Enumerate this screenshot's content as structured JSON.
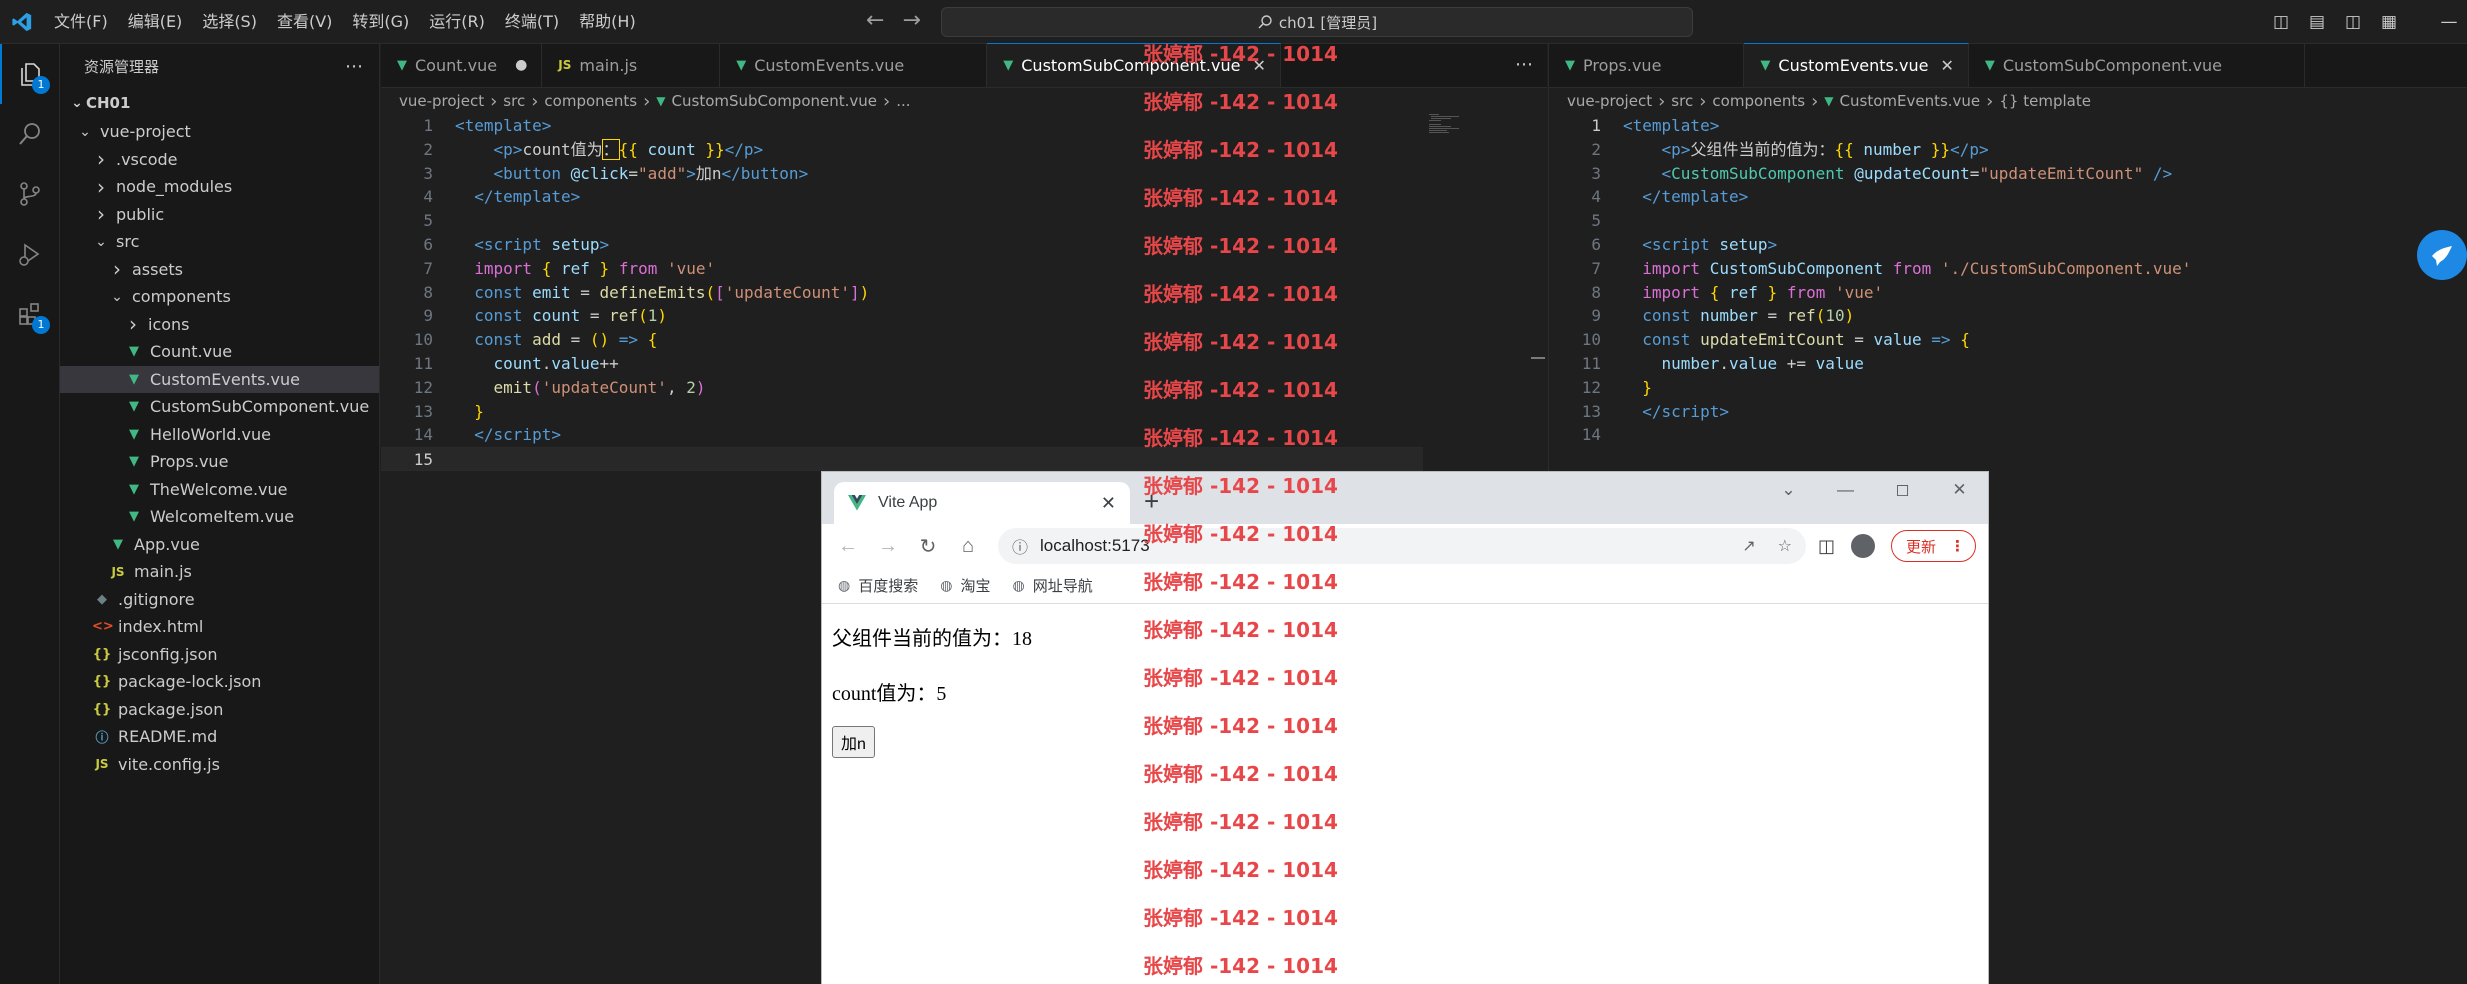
{
  "titlebar": {
    "menus": [
      "文件(F)",
      "编辑(E)",
      "选择(S)",
      "查看(V)",
      "转到(G)",
      "运行(R)",
      "终端(T)",
      "帮助(H)"
    ],
    "command_center": "ch01 [管理员]"
  },
  "activity": {
    "explorer_badge": "1",
    "extensions_badge": "1"
  },
  "explorer": {
    "title": "资源管理器",
    "root": "CH01",
    "tree": [
      {
        "label": "vue-project",
        "depth": 0,
        "chev": "v",
        "icon": ""
      },
      {
        "label": ".vscode",
        "depth": 1,
        "chev": ">",
        "icon": ""
      },
      {
        "label": "node_modules",
        "depth": 1,
        "chev": ">",
        "icon": ""
      },
      {
        "label": "public",
        "depth": 1,
        "chev": ">",
        "icon": ""
      },
      {
        "label": "src",
        "depth": 1,
        "chev": "v",
        "icon": ""
      },
      {
        "label": "assets",
        "depth": 2,
        "chev": ">",
        "icon": ""
      },
      {
        "label": "components",
        "depth": 2,
        "chev": "v",
        "icon": ""
      },
      {
        "label": "icons",
        "depth": 3,
        "chev": ">",
        "icon": ""
      },
      {
        "label": "Count.vue",
        "depth": 3,
        "chev": "",
        "icon": "vue"
      },
      {
        "label": "CustomEvents.vue",
        "depth": 3,
        "chev": "",
        "icon": "vue",
        "selected": true
      },
      {
        "label": "CustomSubComponent.vue",
        "depth": 3,
        "chev": "",
        "icon": "vue"
      },
      {
        "label": "HelloWorld.vue",
        "depth": 3,
        "chev": "",
        "icon": "vue"
      },
      {
        "label": "Props.vue",
        "depth": 3,
        "chev": "",
        "icon": "vue"
      },
      {
        "label": "TheWelcome.vue",
        "depth": 3,
        "chev": "",
        "icon": "vue"
      },
      {
        "label": "WelcomeItem.vue",
        "depth": 3,
        "chev": "",
        "icon": "vue"
      },
      {
        "label": "App.vue",
        "depth": 2,
        "chev": "",
        "icon": "vue"
      },
      {
        "label": "main.js",
        "depth": 2,
        "chev": "",
        "icon": "js"
      },
      {
        "label": ".gitignore",
        "depth": 1,
        "chev": "",
        "icon": "git"
      },
      {
        "label": "index.html",
        "depth": 1,
        "chev": "",
        "icon": "html"
      },
      {
        "label": "jsconfig.json",
        "depth": 1,
        "chev": "",
        "icon": "json"
      },
      {
        "label": "package-lock.json",
        "depth": 1,
        "chev": "",
        "icon": "json"
      },
      {
        "label": "package.json",
        "depth": 1,
        "chev": "",
        "icon": "json"
      },
      {
        "label": "README.md",
        "depth": 1,
        "chev": "",
        "icon": "info"
      },
      {
        "label": "vite.config.js",
        "depth": 1,
        "chev": "",
        "icon": "js"
      }
    ]
  },
  "left_editor": {
    "tabs": [
      {
        "label": "Count.vue",
        "icon": "vue",
        "modified": true
      },
      {
        "label": "main.js",
        "icon": "js"
      },
      {
        "label": "CustomEvents.vue",
        "icon": "vue"
      },
      {
        "label": "CustomSubComponent.vue",
        "icon": "vue",
        "active": true
      }
    ],
    "breadcrumb": [
      "vue-project",
      "src",
      "components",
      "CustomSubComponent.vue",
      "..."
    ],
    "line_count": 15,
    "current_line": 15
  },
  "right_editor": {
    "tabs": [
      {
        "label": "Props.vue",
        "icon": "vue"
      },
      {
        "label": "CustomEvents.vue",
        "icon": "vue",
        "active": true
      },
      {
        "label": "CustomSubComponent.vue",
        "icon": "vue"
      }
    ],
    "breadcrumb": [
      "vue-project",
      "src",
      "components",
      "CustomEvents.vue",
      "{} template"
    ],
    "line_count": 14,
    "current_line": 1
  },
  "watermark": "张婷郁 -142 - 1014",
  "browser": {
    "tab_title": "Vite App",
    "url": "localhost:5173",
    "update_label": "更新",
    "bookmarks": [
      "百度搜索",
      "淘宝",
      "网址导航"
    ],
    "parent_text": "父组件当前的值为：18",
    "count_text": "count值为：5",
    "button_label": "加n"
  },
  "colors": {
    "accent": "#0078d4",
    "vue_green": "#41b883",
    "watermark_red": "#e8474a"
  }
}
